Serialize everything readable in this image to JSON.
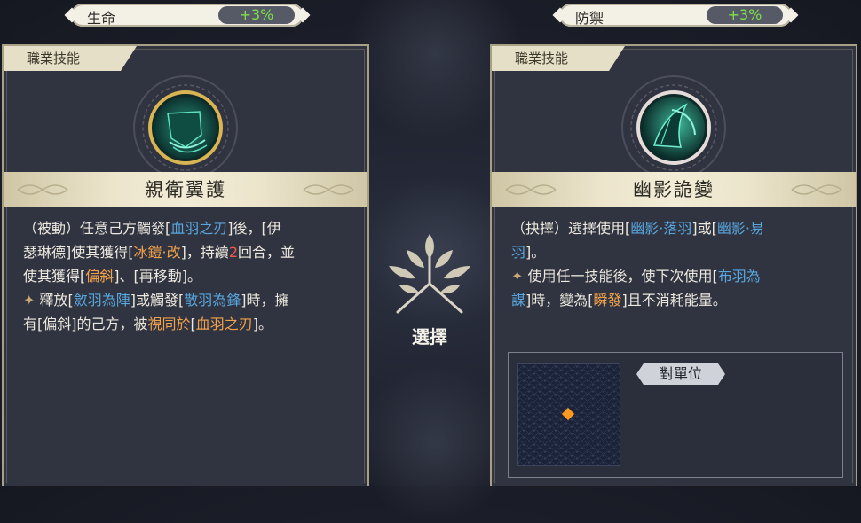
{
  "stats": {
    "left": {
      "name": "生命",
      "value": "+3%"
    },
    "right": {
      "name": "防禦",
      "value": "+3%"
    }
  },
  "colors": {
    "accent_green": "#7de04a",
    "keyword_blue": "#58a7df",
    "keyword_orange": "#f1a24d",
    "number_red": "#f05a4a",
    "gold_border": "#a8a085"
  },
  "left_card": {
    "tab": "職業技能",
    "emblem_icon": "wing-shield-icon",
    "skill_name": "親衛翼護",
    "desc": {
      "l1_a": "（被動）任意己方觸發[",
      "l1_b": "血羽之刃",
      "l1_c": "]後，[伊",
      "l2_a": "瑟琳德]使其獲得[",
      "l2_b": "冰鎧·改",
      "l2_c": "]，持續",
      "l2_d": "2",
      "l2_e": "回合，並",
      "l3_a": "使其獲得[",
      "l3_b": "偏斜",
      "l3_c": "]、[再移動]。",
      "l4_spark": "✦",
      "l4_a": " 釋放[",
      "l4_b": "斂羽為陣",
      "l4_c": "]或觸發[",
      "l4_d": "散羽為鋒",
      "l4_e": "]時，擁",
      "l5_a": "有[偏斜]的己方，被",
      "l5_b": "視同於",
      "l5_c": "[",
      "l5_d": "血羽之刃",
      "l5_e": "]。"
    }
  },
  "right_card": {
    "tab": "職業技能",
    "emblem_icon": "shadow-feather-icon",
    "skill_name": "幽影詭變",
    "desc": {
      "l1_a": "（抉擇）選擇使用[",
      "l1_b": "幽影·落羽",
      "l1_c": "]或[",
      "l1_d": "幽影·易",
      "l2_a": "羽",
      "l2_b": "]。",
      "l3_spark": "✦",
      "l3_a": " 使用任一技能後，使下次使用[",
      "l3_b": "布羽為",
      "l4_a": "謀",
      "l4_b": "]時，變為[",
      "l4_c": "瞬發",
      "l4_d": "]且不消耗能量。"
    },
    "target": {
      "label": "對單位",
      "grid_icon": "target-grid-icon"
    }
  },
  "center": {
    "label": "選擇",
    "icon": "tree-emblem-icon"
  }
}
